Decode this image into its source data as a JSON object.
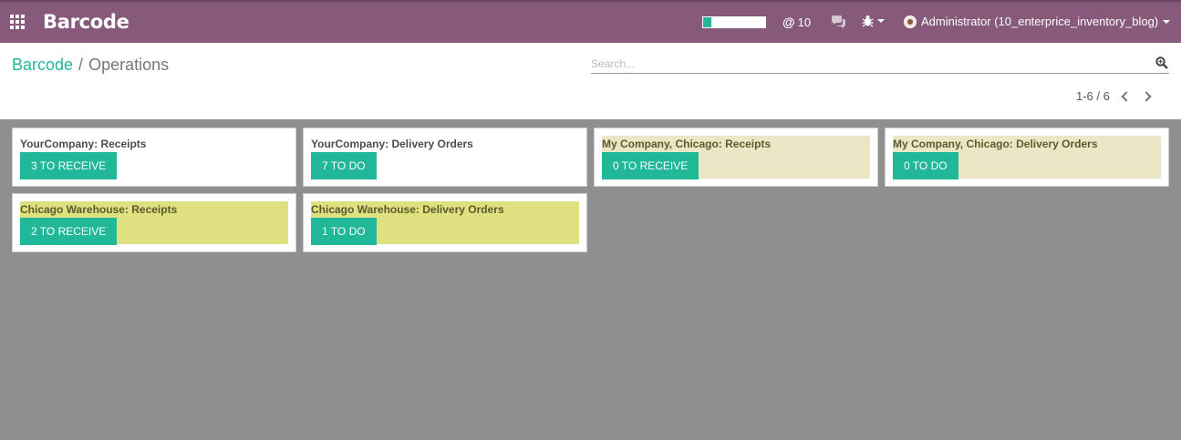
{
  "navbar": {
    "app_title": "Barcode",
    "progress_fraction": 0.13,
    "mentions_count": "10",
    "user_name": "Administrator (10_enterprice_inventory_blog)",
    "bg_color": "#875a7b",
    "icons": [
      "apps-grid-icon",
      "at-icon",
      "chat-icon",
      "bug-icon",
      "avatar"
    ]
  },
  "control_panel": {
    "breadcrumb_root": "Barcode",
    "breadcrumb_separator": "/",
    "breadcrumb_current": "Operations",
    "search_placeholder": "Search...",
    "pager_value": "1-6 / 6"
  },
  "accent_color": "#21b799",
  "cards": [
    {
      "title": "YourCompany: Receipts",
      "button": "3 TO RECEIVE",
      "color": "plain"
    },
    {
      "title": "YourCompany: Delivery Orders",
      "button": "7 TO DO",
      "color": "plain"
    },
    {
      "title": "My Company, Chicago: Receipts",
      "button": "0 TO RECEIVE",
      "color": "beige"
    },
    {
      "title": "My Company, Chicago: Delivery Orders",
      "button": "0 TO DO",
      "color": "beige"
    },
    {
      "title": "Chicago Warehouse: Receipts",
      "button": "2 TO RECEIVE",
      "color": "yellow"
    },
    {
      "title": "Chicago Warehouse: Delivery Orders",
      "button": "1 TO DO",
      "color": "yellow"
    }
  ]
}
